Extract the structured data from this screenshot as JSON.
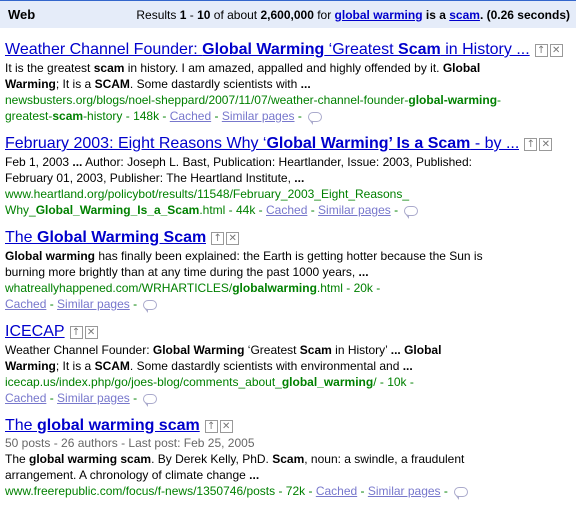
{
  "topbar": {
    "section": "Web",
    "stats_prefix": "Results ",
    "range_start": "1",
    "range_sep": " - ",
    "range_end": "10",
    "of_about": " of about ",
    "total": "2,600,000",
    "for_text": " for ",
    "query_part1": "global warming",
    "query_is": " is a ",
    "query_part2": "scam",
    "time_text": ". (0.26 seconds)"
  },
  "labels": {
    "cached": "Cached",
    "similar": "Similar pages",
    "promote_icon": "promote-icon",
    "remove_icon": "remove-icon"
  },
  "results": [
    {
      "title": [
        {
          "t": "Weather Channel Founder: ",
          "b": false
        },
        {
          "t": "Global Warming",
          "b": true
        },
        {
          "t": " ‘Greatest ",
          "b": false
        },
        {
          "t": "Scam",
          "b": true
        },
        {
          "t": " in History ...",
          "b": false
        }
      ],
      "meta": "",
      "snippet": [
        [
          {
            "t": "It is the greatest ",
            "b": false
          },
          {
            "t": "scam",
            "b": true
          },
          {
            "t": " in history. I am amazed, appalled and highly offended by it. ",
            "b": false
          },
          {
            "t": "Global",
            "b": true
          }
        ],
        [
          {
            "t": "Warming",
            "b": true
          },
          {
            "t": "; It is a ",
            "b": false
          },
          {
            "t": "SCAM",
            "b": true
          },
          {
            "t": ". Some dastardly scientists with ",
            "b": false
          },
          {
            "t": "...",
            "b": true
          }
        ]
      ],
      "url_lines": [
        [
          {
            "t": "newsbusters.org/blogs/noel-sheppard/2007/11/07/weather-channel-founder-",
            "b": false
          },
          {
            "t": "global-warming",
            "b": true
          },
          {
            "t": "-",
            "b": false
          }
        ],
        [
          {
            "t": "greatest-",
            "b": false
          },
          {
            "t": "scam",
            "b": true
          },
          {
            "t": "-history - 148k - ",
            "b": false
          }
        ]
      ],
      "cached_on_own_line": false
    },
    {
      "title": [
        {
          "t": "February 2003: Eight Reasons Why ‘",
          "b": false
        },
        {
          "t": "Global Warming’ Is a Scam",
          "b": true
        },
        {
          "t": " - by ...",
          "b": false
        }
      ],
      "meta": "",
      "snippet": [
        [
          {
            "t": "Feb 1, 2003 ",
            "b": false
          },
          {
            "t": "...",
            "b": true
          },
          {
            "t": " Author: Joseph L. Bast, Publication: Heartlander, Issue: 2003, Published:",
            "b": false
          }
        ],
        [
          {
            "t": "February 01, 2003, Publisher: The Heartland Institute, ",
            "b": false
          },
          {
            "t": "...",
            "b": true
          }
        ]
      ],
      "url_lines": [
        [
          {
            "t": "www.heartland.org/policybot/results/11548/February_2003_Eight_Reasons_",
            "b": false
          }
        ],
        [
          {
            "t": "Why_",
            "b": false
          },
          {
            "t": "Global_Warming_Is_a_Scam",
            "b": true
          },
          {
            "t": ".html - 44k - ",
            "b": false
          }
        ]
      ],
      "cached_on_own_line": false
    },
    {
      "title": [
        {
          "t": "The ",
          "b": false
        },
        {
          "t": "Global Warming Scam",
          "b": true
        }
      ],
      "meta": "",
      "snippet": [
        [
          {
            "t": "Global warming",
            "b": true
          },
          {
            "t": " has finally been explained: the Earth is getting hotter because the Sun is",
            "b": false
          }
        ],
        [
          {
            "t": "burning more brightly than at any time during the past 1000 years, ",
            "b": false
          },
          {
            "t": "...",
            "b": true
          }
        ]
      ],
      "url_lines": [
        [
          {
            "t": "whatreallyhappened.com/WRHARTICLES/",
            "b": false
          },
          {
            "t": "globalwarming",
            "b": true
          },
          {
            "t": ".html - 20k -",
            "b": false
          }
        ]
      ],
      "cached_on_own_line": true
    },
    {
      "title": [
        {
          "t": "ICECAP",
          "b": false
        }
      ],
      "meta": "",
      "snippet": [
        [
          {
            "t": "Weather Channel Founder: ",
            "b": false
          },
          {
            "t": "Global Warming",
            "b": true
          },
          {
            "t": " ‘Greatest ",
            "b": false
          },
          {
            "t": "Scam",
            "b": true
          },
          {
            "t": " in History’ ",
            "b": false
          },
          {
            "t": "...",
            "b": true
          },
          {
            "t": " Global",
            "b": true
          }
        ],
        [
          {
            "t": "Warming",
            "b": true
          },
          {
            "t": "; It is a ",
            "b": false
          },
          {
            "t": "SCAM",
            "b": true
          },
          {
            "t": ". Some dastardly scientists with environmental and ",
            "b": false
          },
          {
            "t": "...",
            "b": true
          }
        ]
      ],
      "url_lines": [
        [
          {
            "t": "icecap.us/index.php/go/joes-blog/comments_about_",
            "b": false
          },
          {
            "t": "global_warming",
            "b": true
          },
          {
            "t": "/ - 10k -",
            "b": false
          }
        ]
      ],
      "cached_on_own_line": true
    },
    {
      "title": [
        {
          "t": "The ",
          "b": false
        },
        {
          "t": "global warming scam",
          "b": true
        }
      ],
      "meta": "50 posts - 26 authors - Last post: Feb 25, 2005",
      "snippet": [
        [
          {
            "t": "The ",
            "b": false
          },
          {
            "t": "global warming scam",
            "b": true
          },
          {
            "t": ". By Derek Kelly, PhD. ",
            "b": false
          },
          {
            "t": "Scam",
            "b": true
          },
          {
            "t": ", noun: a swindle, a fraudulent",
            "b": false
          }
        ],
        [
          {
            "t": "arrangement. A chronology of climate change ",
            "b": false
          },
          {
            "t": "...",
            "b": true
          }
        ]
      ],
      "url_lines": [
        [
          {
            "t": "www.freerepublic.com/focus/f-news/1350746/posts - 72k - ",
            "b": false
          }
        ]
      ],
      "cached_on_own_line": false
    }
  ]
}
